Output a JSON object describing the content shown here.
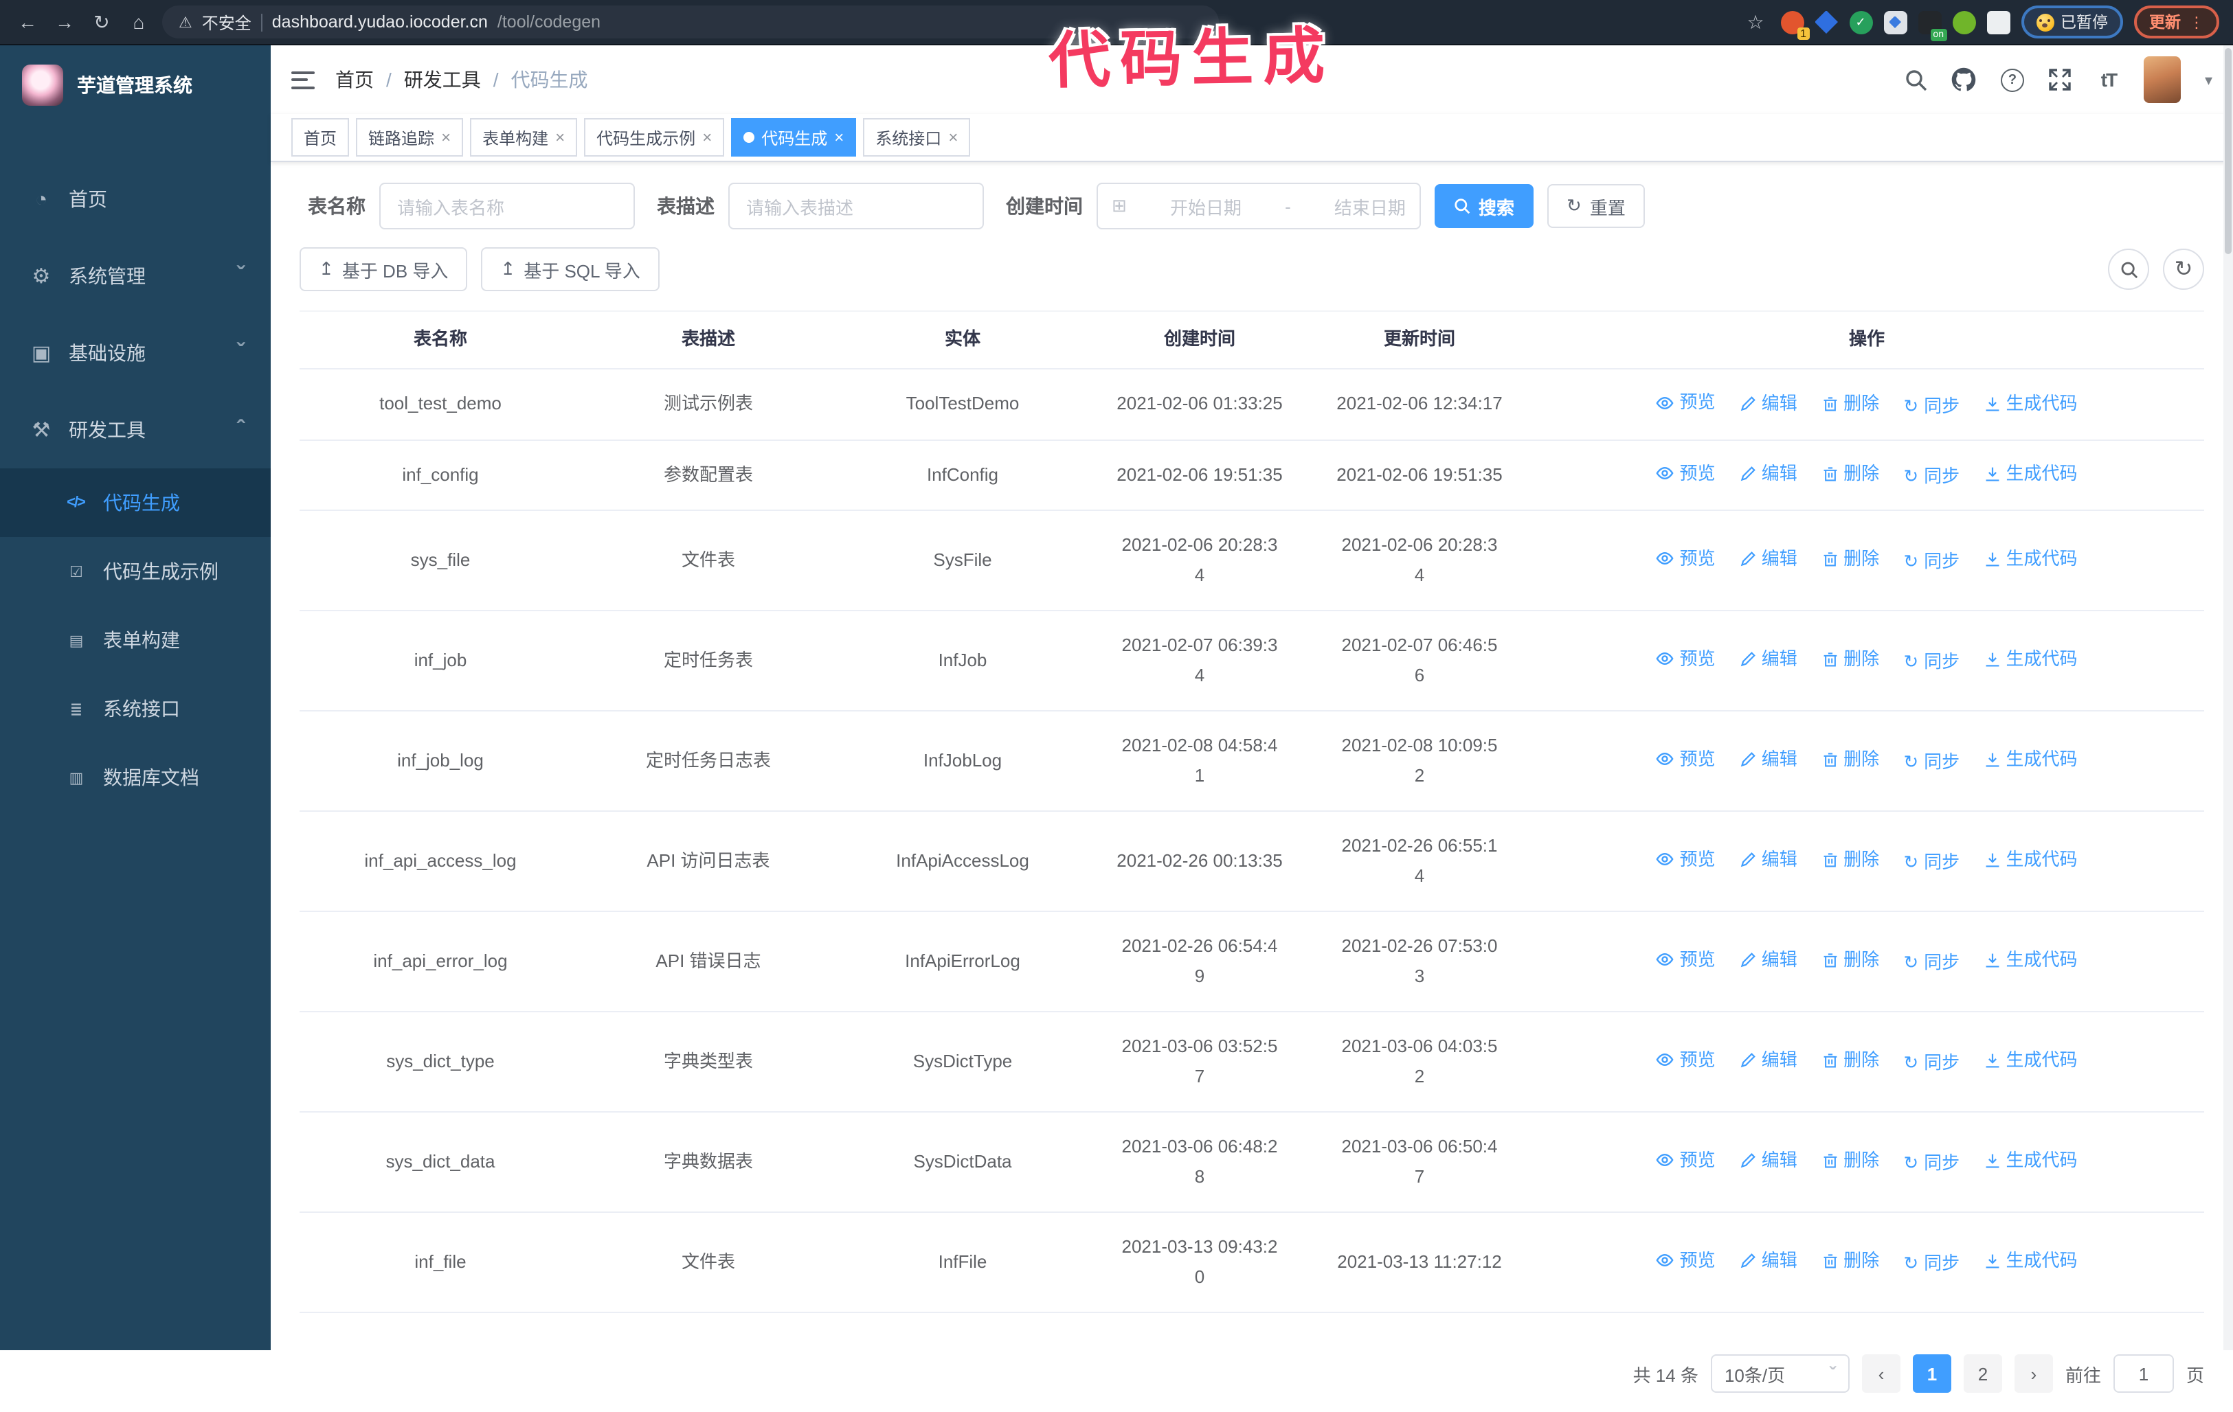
{
  "icons": {
    "back": "←",
    "forward": "→",
    "reload": "↻",
    "home": "⌂",
    "warning": "⚠",
    "star": "☆",
    "check": "✓",
    "dots": "⋮",
    "close": "×",
    "caret": "▾",
    "question": "?",
    "font_size": "tT",
    "calendar": "⊞",
    "upload": "↥",
    "chevron_down": "ˇ",
    "prev": "‹",
    "next": "›"
  },
  "browser": {
    "security_label": "不安全",
    "url_host": "dashboard.yudao.iocoder.cn",
    "url_path": "/tool/codegen",
    "ext_badge_1": "1",
    "ext_badge_on": "on",
    "paused_badge": "已暂停",
    "update_button": "更新"
  },
  "annotation": {
    "text": "代码生成",
    "color": "#f43a60"
  },
  "sidebar": {
    "title": "芋道管理系统",
    "items": [
      {
        "label": "首页",
        "icon": "gauge-icon",
        "glyph": "◔",
        "chevron": ""
      },
      {
        "label": "系统管理",
        "icon": "gear-icon",
        "glyph": "⚙",
        "chevron": "ˇ"
      },
      {
        "label": "基础设施",
        "icon": "monitor-icon",
        "glyph": "▣",
        "chevron": "ˇ"
      },
      {
        "label": "研发工具",
        "icon": "toolbox-icon",
        "glyph": "⚒",
        "chevron": "ˆ"
      }
    ],
    "submenu": [
      {
        "label": "代码生成",
        "icon": "code-icon",
        "glyph": "</>",
        "active": true
      },
      {
        "label": "代码生成示例",
        "icon": "badge-check-icon",
        "glyph": "☑"
      },
      {
        "label": "表单构建",
        "icon": "form-icon",
        "glyph": "▤"
      },
      {
        "label": "系统接口",
        "icon": "sliders-icon",
        "glyph": "≣"
      },
      {
        "label": "数据库文档",
        "icon": "database-icon",
        "glyph": "▥"
      }
    ]
  },
  "header": {
    "breadcrumb": [
      "首页",
      "研发工具",
      "代码生成"
    ],
    "breadcrumb_separator": "/"
  },
  "tabs": [
    {
      "label": "首页",
      "closable": false,
      "active": false
    },
    {
      "label": "链路追踪",
      "closable": true,
      "active": false
    },
    {
      "label": "表单构建",
      "closable": true,
      "active": false
    },
    {
      "label": "代码生成示例",
      "closable": true,
      "active": false
    },
    {
      "label": "代码生成",
      "closable": true,
      "active": true
    },
    {
      "label": "系统接口",
      "closable": true,
      "active": false
    }
  ],
  "filters": {
    "name_label": "表名称",
    "name_placeholder": "请输入表名称",
    "desc_label": "表描述",
    "desc_placeholder": "请输入表描述",
    "time_label": "创建时间",
    "start_placeholder": "开始日期",
    "range_separator": "-",
    "end_placeholder": "结束日期",
    "search_button": "搜索",
    "reset_button": "重置"
  },
  "toolbar": {
    "import_db": "基于 DB 导入",
    "import_sql": "基于 SQL 导入"
  },
  "table": {
    "columns": [
      "表名称",
      "表描述",
      "实体",
      "创建时间",
      "更新时间",
      "操作"
    ],
    "row_actions": [
      {
        "label": "预览",
        "icon": "eye-icon"
      },
      {
        "label": "编辑",
        "icon": "edit-icon"
      },
      {
        "label": "删除",
        "icon": "delete-icon"
      },
      {
        "label": "同步",
        "icon": "sync-icon"
      },
      {
        "label": "生成代码",
        "icon": "download-icon"
      }
    ],
    "rows": [
      {
        "name": "tool_test_demo",
        "desc": "测试示例表",
        "entity": "ToolTestDemo",
        "created": "2021-02-06 01:33:25",
        "updated": "2021-02-06 12:34:17"
      },
      {
        "name": "inf_config",
        "desc": "参数配置表",
        "entity": "InfConfig",
        "created": "2021-02-06 19:51:35",
        "updated": "2021-02-06 19:51:35"
      },
      {
        "name": "sys_file",
        "desc": "文件表",
        "entity": "SysFile",
        "created": "2021-02-06 20:28:3\n4",
        "updated": "2021-02-06 20:28:3\n4"
      },
      {
        "name": "inf_job",
        "desc": "定时任务表",
        "entity": "InfJob",
        "created": "2021-02-07 06:39:3\n4",
        "updated": "2021-02-07 06:46:5\n6"
      },
      {
        "name": "inf_job_log",
        "desc": "定时任务日志表",
        "entity": "InfJobLog",
        "created": "2021-02-08 04:58:4\n1",
        "updated": "2021-02-08 10:09:5\n2"
      },
      {
        "name": "inf_api_access_log",
        "desc": "API 访问日志表",
        "entity": "InfApiAccessLog",
        "created": "2021-02-26 00:13:35",
        "updated": "2021-02-26 06:55:1\n4"
      },
      {
        "name": "inf_api_error_log",
        "desc": "API 错误日志",
        "entity": "InfApiErrorLog",
        "created": "2021-02-26 06:54:4\n9",
        "updated": "2021-02-26 07:53:0\n3"
      },
      {
        "name": "sys_dict_type",
        "desc": "字典类型表",
        "entity": "SysDictType",
        "created": "2021-03-06 03:52:5\n7",
        "updated": "2021-03-06 04:03:5\n2"
      },
      {
        "name": "sys_dict_data",
        "desc": "字典数据表",
        "entity": "SysDictData",
        "created": "2021-03-06 06:48:2\n8",
        "updated": "2021-03-06 06:50:4\n7"
      },
      {
        "name": "inf_file",
        "desc": "文件表",
        "entity": "InfFile",
        "created": "2021-03-13 09:43:2\n0",
        "updated": "2021-03-13 11:27:12"
      }
    ]
  },
  "pagination": {
    "total": "共 14 条",
    "page_size": "10条/页",
    "pages": [
      "1",
      "2"
    ],
    "goto_label": "前往",
    "goto_value": "1",
    "goto_suffix": "页"
  }
}
